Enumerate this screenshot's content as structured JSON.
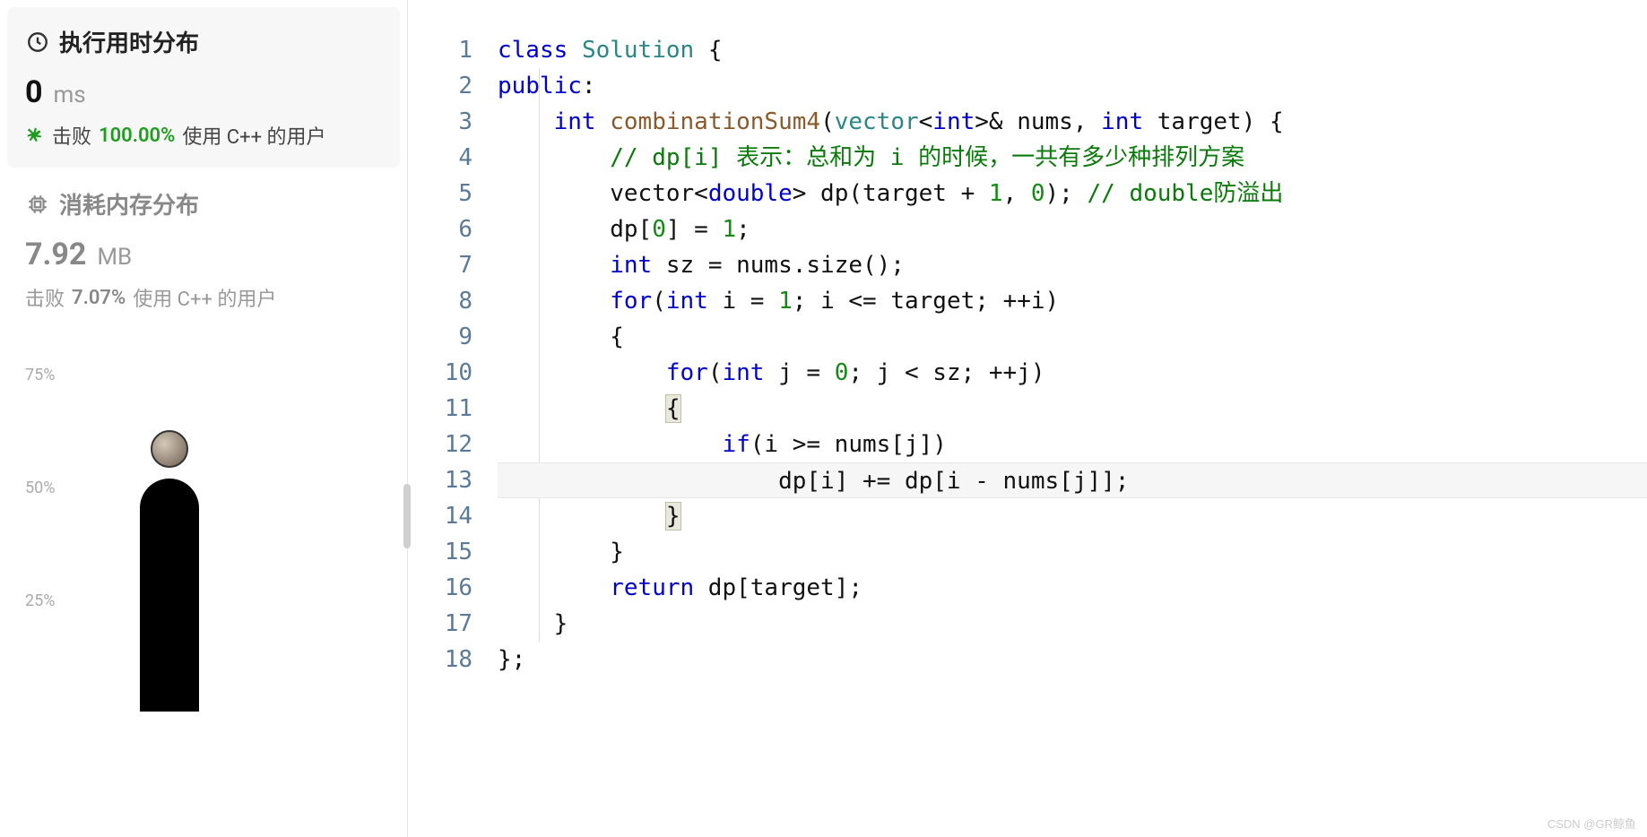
{
  "sidebar": {
    "runtime_title": "执行用时分布",
    "runtime_value": "0",
    "runtime_unit": "ms",
    "beat_label": "击败",
    "runtime_beat_pct": "100.00%",
    "using_label": "使用 C++ 的用户",
    "memory_title": "消耗内存分布",
    "memory_value": "7.92",
    "memory_unit": "MB",
    "memory_beat_pct": "7.07%"
  },
  "chart_data": {
    "type": "bar",
    "y_ticks": [
      "75%",
      "50%",
      "25%"
    ],
    "categories": [
      "0 ms"
    ],
    "values": [
      50
    ],
    "ylim": [
      0,
      100
    ],
    "marker": "avatar"
  },
  "code": {
    "line_numbers": [
      "1",
      "2",
      "3",
      "4",
      "5",
      "6",
      "7",
      "8",
      "9",
      "10",
      "11",
      "12",
      "13",
      "14",
      "15",
      "16",
      "17",
      "18"
    ],
    "l1_class": "class",
    "l1_name": "Solution",
    "l1_brace": " {",
    "l2_public": "public",
    "l2_colon": ":",
    "l3_int": "int",
    "l3_fn": "combinationSum4",
    "l3_p1": "(",
    "l3_vec": "vector",
    "l3_lt": "<",
    "l3_int2": "int",
    "l3_rest": ">& nums, ",
    "l3_int3": "int",
    "l3_rest2": " target) {",
    "l4_comment": "// dp[i] 表示：总和为 i 的时候，一共有多少种排列方案",
    "l5_pre": "vector<",
    "l5_double": "double",
    "l5_mid": "> dp(target + ",
    "l5_n1": "1",
    "l5_mid2": ", ",
    "l5_n0": "0",
    "l5_end": "); ",
    "l5_comment": "// double防溢出",
    "l6_a": "dp[",
    "l6_n": "0",
    "l6_b": "] = ",
    "l6_n2": "1",
    "l6_c": ";",
    "l7_int": "int",
    "l7_rest": " sz = nums.size();",
    "l8_for": "for",
    "l8_p": "(",
    "l8_int": "int",
    "l8_rest": " i = ",
    "l8_n": "1",
    "l8_rest2": "; i <= target; ++i)",
    "l9_brace": "{",
    "l10_for": "for",
    "l10_p": "(",
    "l10_int": "int",
    "l10_rest": " j = ",
    "l10_n": "0",
    "l10_rest2": "; j < sz; ++j)",
    "l11_brace": "{",
    "l12_if": "if",
    "l12_rest": "(i >= nums[j])",
    "l13_body": "dp[i] += dp[i - nums[j]];",
    "l14_brace": "}",
    "l15_brace": "}",
    "l16_ret": "return",
    "l16_rest": " dp[target];",
    "l17_brace": "}",
    "l18_end": "};"
  },
  "watermark": "CSDN @GR鲸鱼"
}
